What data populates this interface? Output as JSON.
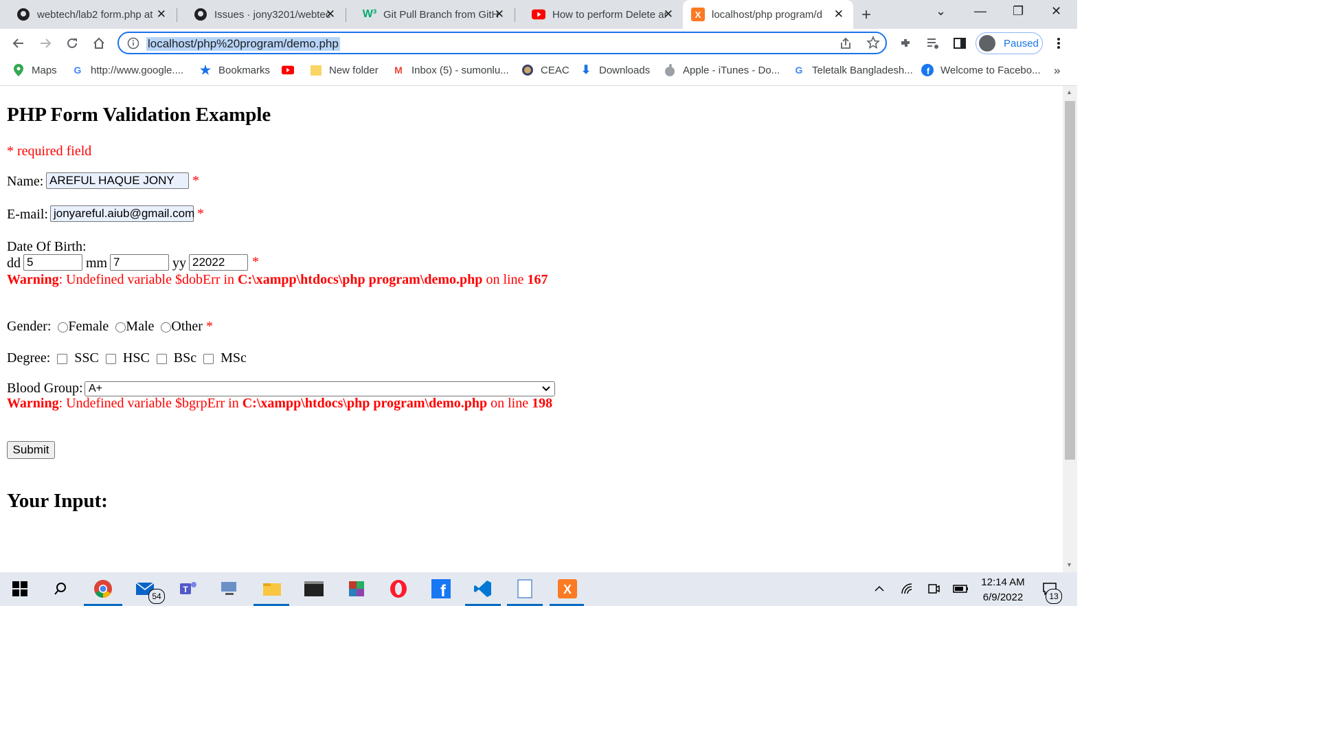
{
  "tabs": [
    {
      "title": "webtech/lab2 form.php at",
      "icon": "github-icon"
    },
    {
      "title": "Issues · jony3201/webtec",
      "icon": "github-icon"
    },
    {
      "title": "Git Pull Branch from GitH",
      "icon": "w3-icon"
    },
    {
      "title": "How to perform Delete ar",
      "icon": "youtube-icon"
    },
    {
      "title": "localhost/php program/d",
      "icon": "xampp-icon",
      "active": true
    }
  ],
  "toolbar": {
    "url": "localhost/php%20program/demo.php",
    "profile_label": "Paused"
  },
  "bookmarks": [
    {
      "label": "Maps",
      "icon": "maps-icon"
    },
    {
      "label": "http://www.google....",
      "icon": "google-icon"
    },
    {
      "label": "Bookmarks",
      "icon": "star-icon"
    },
    {
      "label": "",
      "icon": "youtube-icon"
    },
    {
      "label": "New folder",
      "icon": "folder-icon"
    },
    {
      "label": "Inbox (5) - sumonlu...",
      "icon": "gmail-icon"
    },
    {
      "label": "CEAC",
      "icon": "seal-icon"
    },
    {
      "label": "Downloads",
      "icon": "download-icon"
    },
    {
      "label": "Apple - iTunes - Do...",
      "icon": "apple-icon"
    },
    {
      "label": "Teletalk Bangladesh...",
      "icon": "google-icon"
    },
    {
      "label": "Welcome to Facebo...",
      "icon": "facebook-icon"
    }
  ],
  "page": {
    "heading": "PHP Form Validation Example",
    "required_note": "* required field",
    "name_label": "Name:",
    "name_value": "AREFUL HAQUE JONY",
    "email_label": "E-mail:",
    "email_value": "jonyareful.aiub@gmail.com",
    "asterisk": "*",
    "dob_label": "Date Of Birth:",
    "dd_label": "dd",
    "dd_value": "5",
    "mm_label": "mm",
    "mm_value": "7",
    "yy_label": "yy",
    "yy_value": "22022",
    "warning1": {
      "prefix": "Warning",
      "text": ": Undefined variable $dobErr in ",
      "path": "C:\\xampp\\htdocs\\php program\\demo.php",
      "online": " on line ",
      "line": "167"
    },
    "gender_label": "Gender:",
    "gender_options": [
      "Female",
      "Male",
      "Other"
    ],
    "degree_label": "Degree:",
    "degree_options": [
      "SSC",
      "HSC",
      "BSc",
      "MSc"
    ],
    "blood_label": "Blood Group:",
    "blood_value": "A+",
    "warning2": {
      "prefix": "Warning",
      "text": ": Undefined variable $bgrpErr in ",
      "path": "C:\\xampp\\htdocs\\php program\\demo.php",
      "online": " on line ",
      "line": "198"
    },
    "submit_label": "Submit",
    "your_input": "Your Input:"
  },
  "taskbar": {
    "time": "12:14 AM",
    "date": "6/9/2022",
    "mail_badge": "54",
    "notif_badge": "13"
  },
  "colors": {
    "error_red": "#ff0000",
    "accent_blue": "#1a73e8",
    "autofill_bg": "#e8f0fe"
  }
}
